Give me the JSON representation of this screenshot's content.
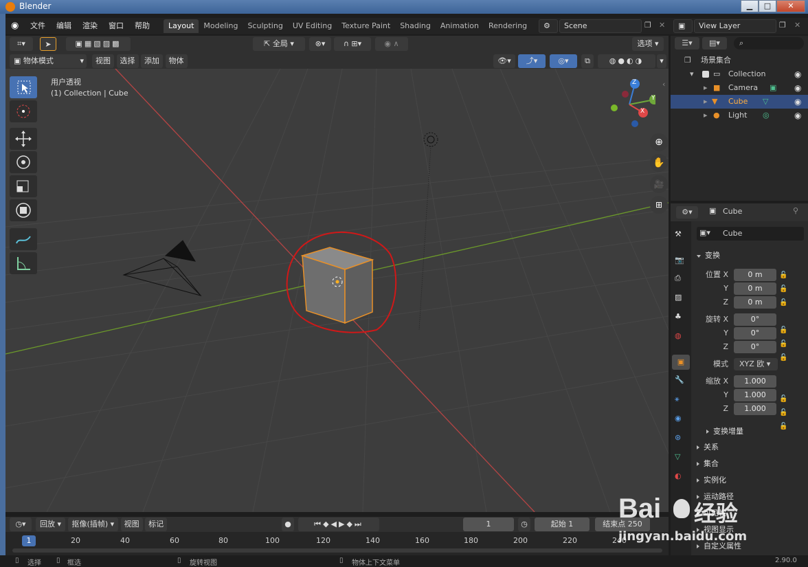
{
  "window": {
    "title": "Blender"
  },
  "menu": [
    "文件",
    "编辑",
    "渲染",
    "窗口",
    "帮助"
  ],
  "workspaces": [
    "Layout",
    "Modeling",
    "Sculpting",
    "UV Editing",
    "Texture Paint",
    "Shading",
    "Animation",
    "Rendering"
  ],
  "scene": "Scene",
  "view_layer": "View Layer",
  "header": {
    "transform_orientation": "全局",
    "options": "选项"
  },
  "viewport_bar": {
    "mode": "物体模式",
    "items": [
      "视图",
      "选择",
      "添加",
      "物体"
    ]
  },
  "viewport": {
    "view_name": "用户透视",
    "collection_info": "(1) Collection | Cube"
  },
  "gizmo": {
    "x": "X",
    "y": "Y",
    "z": "Z"
  },
  "outliner": {
    "root": "场景集合",
    "collection": "Collection",
    "items": [
      "Camera",
      "Cube",
      "Light"
    ]
  },
  "properties": {
    "object_name": "Cube",
    "data_name": "Cube",
    "transform_label": "变换",
    "location": {
      "label": "位置 X",
      "y": "Y",
      "z": "Z",
      "values": [
        "0 m",
        "0 m",
        "0 m"
      ]
    },
    "rotation": {
      "label": "旋转 X",
      "y": "Y",
      "z": "Z",
      "values": [
        "0°",
        "0°",
        "0°"
      ]
    },
    "mode_label": "模式",
    "mode_value": "XYZ 欧",
    "scale": {
      "label": "缩放 X",
      "y": "Y",
      "z": "Z",
      "values": [
        "1.000",
        "1.000",
        "1.000"
      ]
    },
    "delta": "变换增量",
    "sections": [
      "关系",
      "集合",
      "实例化",
      "运动路径",
      "可见性",
      "视图显示",
      "自定义属性"
    ]
  },
  "timeline": {
    "playback": "回放",
    "keying": "抠像(插帧)",
    "view": "视图",
    "marker": "标记",
    "current_frame": "1",
    "start_label": "起始",
    "start": "1",
    "end_label": "结束点",
    "end": "250",
    "ticks": [
      "1",
      "20",
      "40",
      "60",
      "80",
      "100",
      "120",
      "140",
      "160",
      "180",
      "200",
      "220",
      "240"
    ]
  },
  "status": {
    "select": "选择",
    "box": "框选",
    "rotate": "旋转视图",
    "context": "物体上下文菜单",
    "version": "2.90.0"
  },
  "watermark": {
    "brand": "Bai",
    "suffix": "经验",
    "url": "jingyan.baidu.com"
  }
}
